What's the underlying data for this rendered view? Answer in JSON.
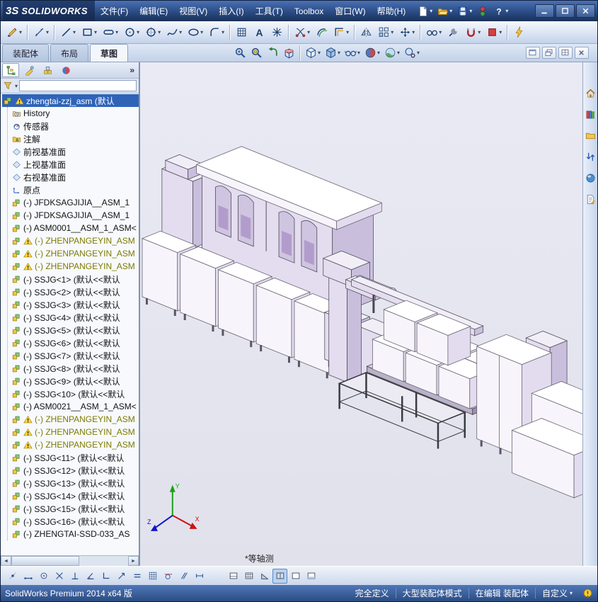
{
  "ui": {
    "dropdown_glyph": "▾",
    "overflow_glyph": "»",
    "scroll_left_glyph": "◄",
    "scroll_right_glyph": "►"
  },
  "titlebar": {
    "logo_mark": "3S",
    "logo_text": "SOLIDWORKS",
    "quick_icons": [
      {
        "n": "new-document-button",
        "i": "newdoc",
        "d": true
      },
      {
        "n": "open-button",
        "i": "open",
        "d": true
      },
      {
        "n": "save-button",
        "i": "save",
        "d": true
      },
      {
        "n": "rebuild-button",
        "i": "rebuild",
        "d": false
      },
      {
        "n": "help-button",
        "i": "helpw",
        "d": true
      }
    ],
    "window_buttons": [
      {
        "n": "minimize-button",
        "i": "winmin"
      },
      {
        "n": "maximize-button",
        "i": "winmax"
      },
      {
        "n": "close-button",
        "i": "winclose"
      }
    ]
  },
  "menus": [
    "文件(F)",
    "编辑(E)",
    "视图(V)",
    "插入(I)",
    "工具(T)",
    "Toolbox",
    "窗口(W)",
    "帮助(H)"
  ],
  "sketch_toolbar": [
    {
      "n": "sketch-button",
      "i": "sketch",
      "d": true
    },
    {
      "sep": true
    },
    {
      "n": "smart-dimension-button",
      "i": "smartdim",
      "d": true
    },
    {
      "sep": true
    },
    {
      "n": "line-button",
      "i": "line",
      "d": true
    },
    {
      "n": "rectangle-button",
      "i": "rect",
      "d": true
    },
    {
      "n": "slot-button",
      "i": "slot",
      "d": true
    },
    {
      "n": "circle-button",
      "i": "circle",
      "d": true
    },
    {
      "n": "perimeter-circle-button",
      "i": "pcircle",
      "d": true
    },
    {
      "n": "spline-button",
      "i": "spline",
      "d": true
    },
    {
      "n": "ellipse-button",
      "i": "ellipse",
      "d": true
    },
    {
      "n": "fillet-button",
      "i": "fillet",
      "d": true
    },
    {
      "sep": true
    },
    {
      "n": "sketch-picture-button",
      "i": "mesh",
      "d": false
    },
    {
      "n": "text-button",
      "i": "textA",
      "d": false
    },
    {
      "n": "point-button",
      "i": "point",
      "d": false
    },
    {
      "sep": true
    },
    {
      "n": "trim-entities-button",
      "i": "trim",
      "d": true
    },
    {
      "n": "convert-entities-button",
      "i": "convert",
      "d": false
    },
    {
      "n": "offset-entities-button",
      "i": "offset",
      "d": true
    },
    {
      "sep": true
    },
    {
      "n": "mirror-entities-button",
      "i": "mirror",
      "d": false
    },
    {
      "n": "linear-pattern-button",
      "i": "lpattern",
      "d": true
    },
    {
      "n": "move-entities-button",
      "i": "move",
      "d": true
    },
    {
      "sep": true
    },
    {
      "n": "display-relations-button",
      "i": "relations",
      "d": true
    },
    {
      "n": "repair-sketch-button",
      "i": "repair",
      "d": false
    },
    {
      "n": "quick-snaps-button",
      "i": "qsnaps",
      "d": true
    },
    {
      "n": "no-solve-move-button",
      "i": "nosolve",
      "d": true
    },
    {
      "sep": true
    },
    {
      "n": "instant2d-button",
      "i": "bolt",
      "d": false
    }
  ],
  "command_tabs": [
    {
      "label": "装配体",
      "active": false
    },
    {
      "label": "布局",
      "active": false
    },
    {
      "label": "草图",
      "active": true
    }
  ],
  "headsup_toolbar": [
    {
      "n": "zoom-fit-button",
      "i": "zoomfit",
      "d": false
    },
    {
      "n": "zoom-area-button",
      "i": "zoomarea",
      "d": false
    },
    {
      "n": "previous-view-button",
      "i": "prevview",
      "d": false
    },
    {
      "n": "section-view-button",
      "i": "section",
      "d": false
    },
    {
      "sep": true
    },
    {
      "n": "view-orientation-button",
      "i": "cube",
      "d": true
    },
    {
      "n": "display-style-button",
      "i": "dispstyle",
      "d": true
    },
    {
      "n": "hide-show-items-button",
      "i": "hideshow",
      "d": true
    },
    {
      "n": "edit-appearance-button",
      "i": "editappearance",
      "d": true
    },
    {
      "n": "apply-scene-button",
      "i": "sceneball",
      "d": true
    },
    {
      "n": "view-settings-button",
      "i": "viewsettings",
      "d": true
    }
  ],
  "mdi_buttons": [
    {
      "n": "doc-restore-button",
      "i": "mdiwin"
    },
    {
      "n": "doc-cascade-button",
      "i": "mdiwin2"
    },
    {
      "n": "doc-split-button",
      "i": "mdiwin3"
    },
    {
      "n": "doc-close-button",
      "i": "mdiclose"
    }
  ],
  "left_panel": {
    "tabs": [
      {
        "n": "featuremanager-tab",
        "i": "fmtab"
      },
      {
        "n": "propertymanager-tab",
        "i": "pmtab"
      },
      {
        "n": "configurationmanager-tab",
        "i": "cmtab"
      },
      {
        "n": "displaymanager-tab",
        "i": "dmtab"
      }
    ],
    "overflow": "»",
    "filter_value": ""
  },
  "tree": {
    "root": {
      "icon": "assembly",
      "warn": true,
      "label": "zhengtai-zzj_asm (默认"
    },
    "items": [
      {
        "icon": "history",
        "label": "History"
      },
      {
        "icon": "sensors",
        "label": "传感器"
      },
      {
        "icon": "annotations",
        "label": "注解"
      },
      {
        "icon": "plane",
        "label": "前视基准面"
      },
      {
        "icon": "plane",
        "label": "上视基准面"
      },
      {
        "icon": "plane",
        "label": "右视基准面"
      },
      {
        "icon": "origin",
        "label": "原点"
      },
      {
        "icon": "assembly",
        "label": "(-) JFDKSAGJIJIA__ASM_1"
      },
      {
        "icon": "assembly",
        "label": "(-) JFDKSAGJIJIA__ASM_1"
      },
      {
        "icon": "assembly",
        "label": "(-) ASM0001__ASM_1_ASM<"
      },
      {
        "icon": "assembly",
        "warn": true,
        "olive": true,
        "label": "(-) ZHENPANGEYIN_ASM"
      },
      {
        "icon": "assembly",
        "warn": true,
        "olive": true,
        "label": "(-) ZHENPANGEYIN_ASM"
      },
      {
        "icon": "assembly",
        "warn": true,
        "olive": true,
        "label": "(-) ZHENPANGEYIN_ASM"
      },
      {
        "icon": "assembly",
        "label": "(-) SSJG<1> (默认<<默认"
      },
      {
        "icon": "assembly",
        "label": "(-) SSJG<2> (默认<<默认"
      },
      {
        "icon": "assembly",
        "label": "(-) SSJG<3> (默认<<默认"
      },
      {
        "icon": "assembly",
        "label": "(-) SSJG<4> (默认<<默认"
      },
      {
        "icon": "assembly",
        "label": "(-) SSJG<5> (默认<<默认"
      },
      {
        "icon": "assembly",
        "label": "(-) SSJG<6> (默认<<默认"
      },
      {
        "icon": "assembly",
        "label": "(-) SSJG<7> (默认<<默认"
      },
      {
        "icon": "assembly",
        "label": "(-) SSJG<8> (默认<<默认"
      },
      {
        "icon": "assembly",
        "label": "(-) SSJG<9> (默认<<默认"
      },
      {
        "icon": "assembly",
        "label": "(-) SSJG<10> (默认<<默认"
      },
      {
        "icon": "assembly",
        "label": "(-) ASM0021__ASM_1_ASM<"
      },
      {
        "icon": "assembly",
        "warn": true,
        "olive": true,
        "label": "(-) ZHENPANGEYIN_ASM"
      },
      {
        "icon": "assembly",
        "warn": true,
        "olive": true,
        "label": "(-) ZHENPANGEYIN_ASM"
      },
      {
        "icon": "assembly",
        "warn": true,
        "olive": true,
        "label": "(-) ZHENPANGEYIN_ASM"
      },
      {
        "icon": "assembly",
        "label": "(-) SSJG<11> (默认<<默认"
      },
      {
        "icon": "assembly",
        "label": "(-) SSJG<12> (默认<<默认"
      },
      {
        "icon": "assembly",
        "label": "(-) SSJG<13> (默认<<默认"
      },
      {
        "icon": "assembly",
        "label": "(-) SSJG<14> (默认<<默认"
      },
      {
        "icon": "assembly",
        "label": "(-) SSJG<15> (默认<<默认"
      },
      {
        "icon": "assembly",
        "label": "(-) SSJG<16> (默认<<默认"
      },
      {
        "icon": "assembly",
        "label": "(-) ZHENGTAI-SSD-033_AS"
      }
    ]
  },
  "viewport": {
    "view_label": "*等轴测"
  },
  "task_pane": [
    {
      "n": "home-button",
      "i": "home"
    },
    {
      "n": "design-library-button",
      "i": "dlib"
    },
    {
      "n": "file-explorer-button",
      "i": "folder"
    },
    {
      "n": "view-palette-button",
      "i": "palette"
    },
    {
      "n": "appearances-button",
      "i": "appear"
    },
    {
      "n": "custom-properties-button",
      "i": "props"
    }
  ],
  "bottom_toolbar": {
    "snaps": [
      {
        "n": "snap-points-button",
        "i": "sdot"
      },
      {
        "n": "snap-midpoints-button",
        "i": "sline"
      },
      {
        "n": "snap-center-button",
        "i": "scenter"
      },
      {
        "n": "snap-intersections-button",
        "i": "sx"
      },
      {
        "n": "snap-perpendicular-button",
        "i": "sperp"
      },
      {
        "n": "snap-angle-button",
        "i": "sangle"
      },
      {
        "n": "snap-corner-button",
        "i": "scorner"
      },
      {
        "n": "snap-nearest-button",
        "i": "sarrow"
      },
      {
        "n": "snap-hv-button",
        "i": "sh"
      },
      {
        "n": "snap-grid-button",
        "i": "sgrid"
      },
      {
        "n": "snap-tangent-button",
        "i": "stan"
      },
      {
        "n": "snap-parallel-button",
        "i": "spar"
      },
      {
        "n": "snap-length-button",
        "i": "slen"
      }
    ],
    "panes": [
      {
        "n": "viewport-frame-button",
        "i": "pframe"
      },
      {
        "n": "viewport-grid-button",
        "i": "pgrid"
      },
      {
        "n": "viewport-triangle-button",
        "i": "ptri"
      },
      {
        "n": "viewport-two-view-button",
        "i": "ptwo",
        "active": true
      },
      {
        "n": "viewport-single-view-button",
        "i": "pone"
      },
      {
        "n": "viewport-bottom-view-button",
        "i": "pbottom"
      }
    ]
  },
  "statusbar": {
    "left": "SolidWorks Premium 2014 x64 版",
    "defined": "完全定义",
    "mode": "大型装配体模式",
    "editing": "在编辑 装配体",
    "custom": "自定义"
  }
}
